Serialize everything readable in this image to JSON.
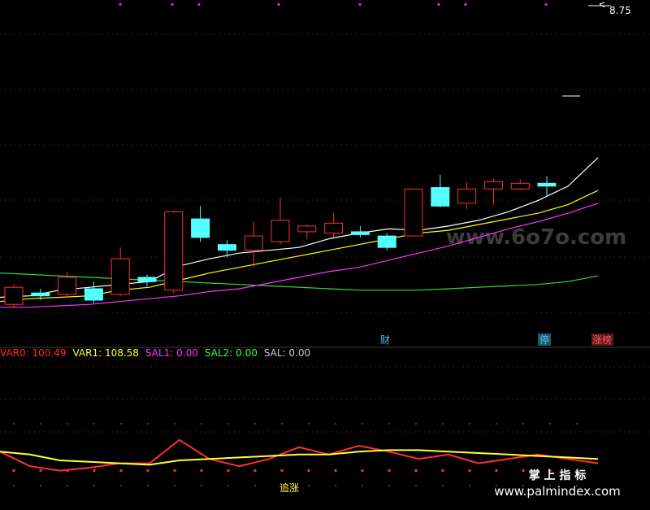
{
  "upper_panel": {
    "price_label": "8.75",
    "markers": [
      {
        "text": "财",
        "color": "#4fc3f7"
      },
      {
        "text": "停",
        "color": "#4fc3f7"
      },
      {
        "text": "涨榜",
        "color": "#ff5a5a"
      }
    ],
    "watermark": "www.6o7o.com"
  },
  "indicator_header": [
    {
      "text": "VAR0: 100.49",
      "color": "#ff2a2a"
    },
    {
      "text": "VAR1: 108.58",
      "color": "#ffff33"
    },
    {
      "text": "SAL1: 0.00",
      "color": "#ff33ff"
    },
    {
      "text": "SAL2: 0.00",
      "color": "#33ff33"
    },
    {
      "text": "SAL: 0.00",
      "color": "#cccccc"
    }
  ],
  "lower_panel": {
    "signal_label": "追涨",
    "brand_cn": "掌 上 指 标",
    "brand_url": "www.palmindex.com"
  },
  "colors": {
    "up": "#ff3030",
    "down": "#54ffff",
    "ma5": "#ffffff",
    "ma10": "#ffff00",
    "ma20": "#ff33ff",
    "ma60": "#33dd33",
    "grid": "#8b1a1a"
  },
  "chart_data": {
    "type": "candlestick",
    "candles": [
      {
        "o": 7.02,
        "c": 7.14,
        "h": 7.16,
        "l": 7.0
      },
      {
        "o": 7.1,
        "c": 7.08,
        "h": 7.13,
        "l": 7.05
      },
      {
        "o": 7.09,
        "c": 7.21,
        "h": 7.25,
        "l": 7.07
      },
      {
        "o": 7.13,
        "c": 7.05,
        "h": 7.18,
        "l": 7.03
      },
      {
        "o": 7.09,
        "c": 7.34,
        "h": 7.42,
        "l": 7.08
      },
      {
        "o": 7.21,
        "c": 7.18,
        "h": 7.23,
        "l": 7.15
      },
      {
        "o": 7.12,
        "c": 7.67,
        "h": 7.68,
        "l": 7.1
      },
      {
        "o": 7.62,
        "c": 7.49,
        "h": 7.71,
        "l": 7.46
      },
      {
        "o": 7.44,
        "c": 7.4,
        "h": 7.47,
        "l": 7.35
      },
      {
        "o": 7.4,
        "c": 7.5,
        "h": 7.6,
        "l": 7.28
      },
      {
        "o": 7.46,
        "c": 7.61,
        "h": 7.77,
        "l": 7.44
      },
      {
        "o": 7.53,
        "c": 7.57,
        "h": 7.58,
        "l": 7.48
      },
      {
        "o": 7.52,
        "c": 7.59,
        "h": 7.66,
        "l": 7.49
      },
      {
        "o": 7.53,
        "c": 7.51,
        "h": 7.57,
        "l": 7.49
      },
      {
        "o": 7.5,
        "c": 7.42,
        "h": 7.52,
        "l": 7.4
      },
      {
        "o": 7.5,
        "c": 7.83,
        "h": 7.83,
        "l": 7.5
      },
      {
        "o": 7.84,
        "c": 7.71,
        "h": 7.93,
        "l": 7.7
      },
      {
        "o": 7.73,
        "c": 7.83,
        "h": 7.88,
        "l": 7.69
      },
      {
        "o": 7.83,
        "c": 7.88,
        "h": 7.9,
        "l": 7.72
      },
      {
        "o": 7.83,
        "c": 7.87,
        "h": 7.9,
        "l": 7.82
      },
      {
        "o": 7.87,
        "c": 7.85,
        "h": 7.92,
        "l": 7.78
      }
    ],
    "ma5": [
      7.07,
      7.08,
      7.12,
      7.14,
      7.16,
      7.18,
      7.29,
      7.34,
      7.38,
      7.4,
      7.42,
      7.48,
      7.52,
      7.55,
      7.54,
      7.57,
      7.61,
      7.67,
      7.75,
      7.85,
      8.05
    ],
    "ma10": [
      7.04,
      7.06,
      7.07,
      7.08,
      7.12,
      7.14,
      7.19,
      7.24,
      7.28,
      7.32,
      7.36,
      7.4,
      7.44,
      7.48,
      7.52,
      7.54,
      7.58,
      7.62,
      7.66,
      7.72,
      7.82
    ],
    "ma20": [
      7.0,
      7.0,
      7.01,
      7.02,
      7.04,
      7.06,
      7.08,
      7.11,
      7.13,
      7.17,
      7.21,
      7.25,
      7.28,
      7.33,
      7.38,
      7.43,
      7.49,
      7.55,
      7.6,
      7.66,
      7.73
    ],
    "ma60": [
      7.24,
      7.23,
      7.22,
      7.21,
      7.2,
      7.19,
      7.18,
      7.17,
      7.16,
      7.15,
      7.14,
      7.13,
      7.12,
      7.12,
      7.12,
      7.13,
      7.14,
      7.15,
      7.16,
      7.18,
      7.22
    ],
    "var0": [
      0.8,
      0.3,
      0.15,
      0.25,
      0.4,
      0.4,
      1.2,
      0.55,
      0.3,
      0.55,
      0.95,
      0.7,
      1.0,
      0.8,
      0.55,
      0.7,
      0.4,
      0.55,
      0.7,
      0.55,
      0.4
    ],
    "var1": [
      0.8,
      0.7,
      0.5,
      0.45,
      0.4,
      0.35,
      0.5,
      0.55,
      0.6,
      0.65,
      0.7,
      0.7,
      0.8,
      0.85,
      0.85,
      0.8,
      0.75,
      0.7,
      0.65,
      0.6,
      0.55
    ]
  }
}
